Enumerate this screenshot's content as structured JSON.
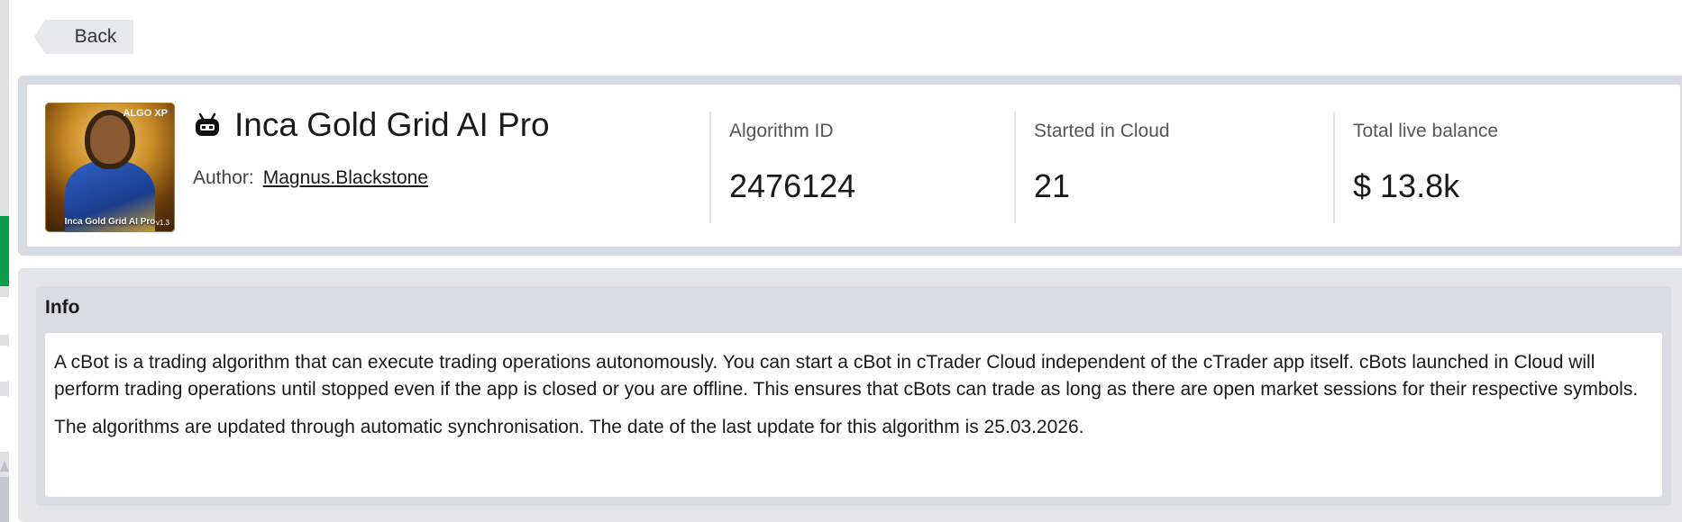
{
  "nav": {
    "back_label": "Back"
  },
  "algorithm": {
    "name": "Inca Gold Grid AI Pro",
    "author_label": "Author:",
    "author_name": "Magnus.Blackstone",
    "logo": {
      "caption": "Inca Gold Grid AI Pro",
      "badge": "ALGO XP",
      "version": "v1.3"
    }
  },
  "stats": [
    {
      "label": "Algorithm ID",
      "value": "2476124"
    },
    {
      "label": "Started in Cloud",
      "value": "21"
    },
    {
      "label": "Total live balance",
      "value": "$ 13.8k"
    }
  ],
  "info": {
    "title": "Info",
    "paragraphs": [
      "A cBot is a trading algorithm that can execute trading operations autonomously. You can start a cBot in cTrader Cloud independent of the cTrader app itself. cBots launched in Cloud will perform trading operations until stopped even if the app is closed or you are offline. This ensures that cBots can trade as long as there are open market sessions for their respective symbols.",
      "The algorithms are updated through automatic synchronisation. The date of the last update for this algorithm is 25.03.2026."
    ]
  },
  "colors": {
    "accent_green": "#0a9a4a",
    "panel_grey": "#d6dce2"
  },
  "icons": {
    "bot": "robot-icon",
    "back": "back-arrow-icon"
  }
}
